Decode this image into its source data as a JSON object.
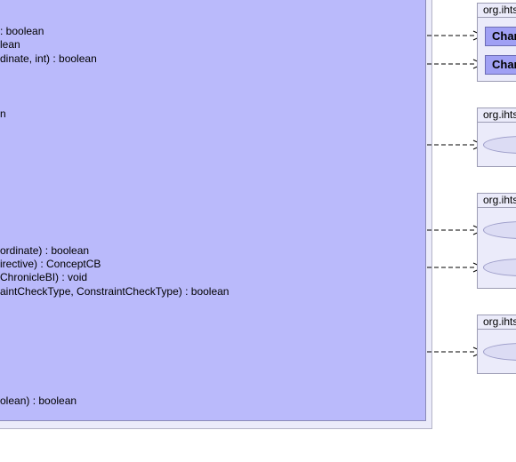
{
  "main_class": {
    "methods": [
      ": boolean",
      "lean",
      "dinate, int) : boolean",
      "n",
      "ordinate) : boolean",
      "irective) : ConceptCB",
      "ChronicleBI) : void",
      "aintCheckType, ConstraintCheckType) : boolean",
      "olean) : boolean"
    ]
  },
  "packages": [
    {
      "name": "org.ihts",
      "classes": [
        "Char",
        "Char"
      ]
    },
    {
      "name": "org.ihts"
    },
    {
      "name": "org.ihts"
    },
    {
      "name": "org.ihts"
    }
  ],
  "colors": {
    "class_fill": "#babafb",
    "class_shadow": "#ebebfa",
    "package_fill": "#ebebfa",
    "interface_box_fill": "#a0a0f4",
    "ellipse_fill": "#dcdcf4"
  }
}
